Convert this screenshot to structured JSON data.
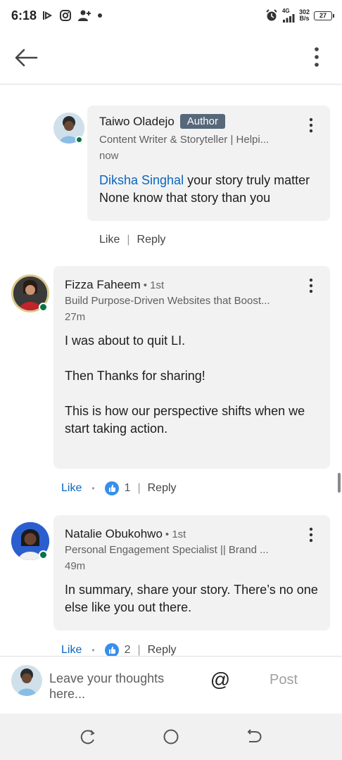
{
  "status_bar": {
    "time": "6:18",
    "net_speed_value": "302",
    "net_speed_unit": "B/s",
    "network": "4G",
    "battery": "27"
  },
  "header": {
    "back_icon": "arrow-left-icon",
    "more_icon": "vertical-dots-icon"
  },
  "comments": [
    {
      "name": "Taiwo Oladejo",
      "badge": "Author",
      "headline": "Content Writer & Storyteller | Helpi...",
      "time": "now",
      "mention": "Diksha Singhal",
      "text": " your story truly matter None know that story than you",
      "like_label": "Like",
      "reply_label": "Reply"
    },
    {
      "name": "Fizza Faheem",
      "degree": "• 1st",
      "headline": "Build Purpose-Driven Websites that Boost...",
      "time": "27m",
      "paragraphs": [
        "I was about to quit LI.",
        "Then Thanks for sharing!",
        "This is how our perspective shifts when we start taking action."
      ],
      "like_label": "Like",
      "reaction_count": "1",
      "reply_label": "Reply"
    },
    {
      "name": "Natalie Obukohwo",
      "degree": "• 1st",
      "headline": "Personal Engagement Specialist || Brand ...",
      "time": "49m",
      "text": "In summary, share your story. There’s no one else like you out there.",
      "like_label": "Like",
      "reaction_count": "2",
      "reply_label": "Reply"
    }
  ],
  "composer": {
    "placeholder": "Leave your thoughts here...",
    "at_symbol": "@",
    "post_label": "Post"
  },
  "colors": {
    "accent": "#0a66c2",
    "bubble": "#f2f2f2",
    "author_badge": "#56687a",
    "online": "#057642"
  }
}
